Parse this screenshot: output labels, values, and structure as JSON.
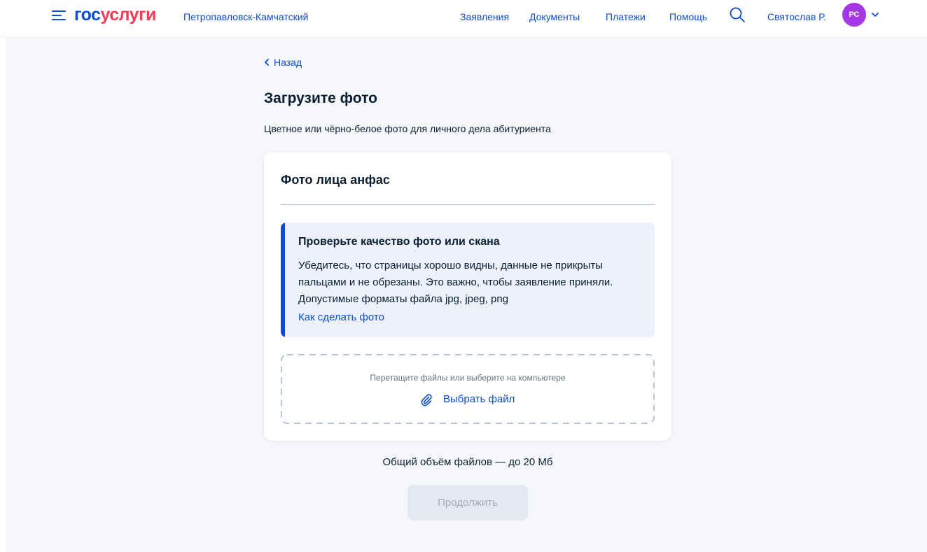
{
  "header": {
    "logo_part1": "гос",
    "logo_part2": "услуги",
    "city": "Петропавловск-Камчатский",
    "nav": [
      {
        "label": "Заявления"
      },
      {
        "label": "Документы"
      },
      {
        "label": "Платежи"
      },
      {
        "label": "Помощь"
      }
    ],
    "user_name": "Святослав Р.",
    "avatar_initials": "РС",
    "icons": {
      "menu": "burger-menu-icon",
      "search": "search-icon",
      "chevron": "chevron-down-icon"
    }
  },
  "page": {
    "back_label": "Назад",
    "title": "Загрузите фото",
    "subtitle": "Цветное или чёрно-белое фото для личного дела абитуриента"
  },
  "card": {
    "title": "Фото лица анфас",
    "notice": {
      "title": "Проверьте качество фото или скана",
      "text_lines": [
        "Убедитесь, что страницы хорошо видны, данные не прикрыты",
        "пальцами и не обрезаны. Это важно, чтобы заявление приняли.",
        "Допустимые форматы файла jpg, jpeg, png"
      ],
      "link": "Как сделать фото"
    },
    "dropzone": {
      "hint": "Перетащите файлы или выберите на компьютере",
      "pick_label": "Выбрать файл",
      "icon": "paperclip-icon"
    }
  },
  "footer": {
    "total_size": "Общий объём файлов — до 20 Мб",
    "continue_label": "Продолжить"
  },
  "colors": {
    "primary": "#0d4cd3",
    "brand_red": "#ee3f58",
    "avatar": "#a637e5",
    "notice_bg": "#ecf1fb",
    "page_bg": "#f5f7fa",
    "disabled_bg": "#e4e9f3"
  }
}
